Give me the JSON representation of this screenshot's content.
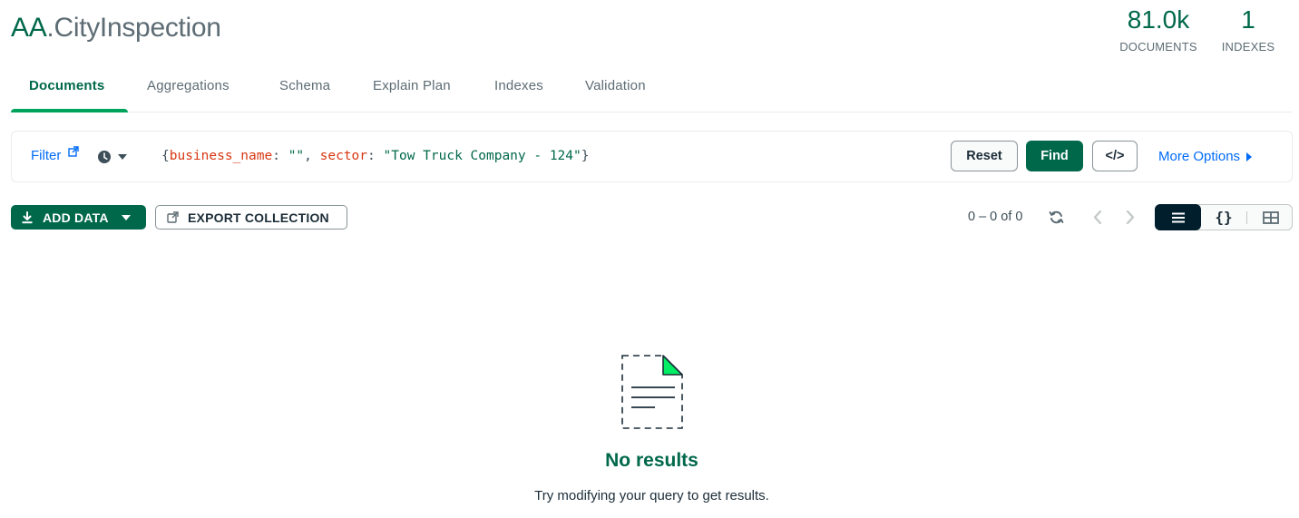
{
  "header": {
    "db_name": "AA",
    "separator": ".",
    "collection_name": "CityInspection",
    "stats": [
      {
        "value": "81.0k",
        "label": "DOCUMENTS"
      },
      {
        "value": "1",
        "label": "INDEXES"
      }
    ]
  },
  "tabs": [
    {
      "label": "Documents",
      "active": true
    },
    {
      "label": "Aggregations"
    },
    {
      "label": "Schema"
    },
    {
      "label": "Explain Plan"
    },
    {
      "label": "Indexes"
    },
    {
      "label": "Validation"
    }
  ],
  "query_bar": {
    "filter_label": "Filter",
    "query": {
      "open": "{",
      "key1": "business_name",
      "colon1": ": ",
      "val1": "\"\"",
      "comma": ", ",
      "key2": "sector",
      "colon2": ": ",
      "val2": "\"Tow Truck Company - 124\"",
      "close": "}"
    },
    "reset_label": "Reset",
    "find_label": "Find",
    "code_label": "</>",
    "more_options_label": "More Options"
  },
  "toolbar": {
    "add_data_label": "ADD DATA",
    "export_label": "EXPORT COLLECTION",
    "pagination": "0 – 0 of 0",
    "json_view_label": "{}"
  },
  "empty_state": {
    "title": "No results",
    "subtitle": "Try modifying your query to get results."
  },
  "colors": {
    "brand_green": "#00684a",
    "accent_green": "#00a35c",
    "link_blue": "#016bf8",
    "key_red": "#d83713",
    "dark_navy": "#001e2b"
  },
  "icons": [
    "external-link-icon",
    "history-clock-icon",
    "download-icon",
    "export-icon",
    "refresh-icon",
    "chevron-left-icon",
    "chevron-right-icon",
    "list-view-icon",
    "table-view-icon",
    "empty-document-icon"
  ]
}
